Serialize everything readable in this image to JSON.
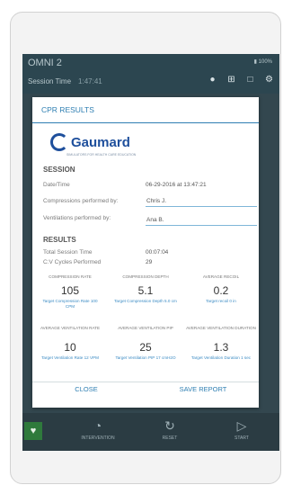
{
  "app": {
    "title": "OMNI 2",
    "battery": "▮ 100%",
    "session_label": "Session Time",
    "session_value": "1:47:41"
  },
  "app_icons": [
    "palette-icon",
    "users-icon",
    "chat-icon",
    "gear-icon"
  ],
  "dialog": {
    "title": "CPR RESULTS",
    "logo": {
      "name": "Gaumard",
      "tagline": "SIMULATORS FOR HEALTH CARE EDUCATION"
    },
    "session": {
      "heading": "SESSION",
      "date_label": "Date/Time",
      "date_value": "06-29-2016 at 13:47:21",
      "compressions_label": "Compressions performed by:",
      "compressions_value": "Chris J.",
      "ventilations_label": "Ventilations performed by:",
      "ventilations_value": "Ana B."
    },
    "results": {
      "heading": "RESULTS",
      "total_label": "Total Session Time",
      "total_value": "00:07:04",
      "cycles_label": "C:V Cycles Performed",
      "cycles_value": "29"
    },
    "stats": [
      {
        "label": "COMPRESSION RATE",
        "value": "105",
        "target": "Target Compression Rate 100 CPM"
      },
      {
        "label": "COMPRESSION DEPTH",
        "value": "5.1",
        "target": "Target Compression Depth 5.0 cm"
      },
      {
        "label": "AVERAGE RECOIL",
        "value": "0.2",
        "target": "Target recoil 0 in"
      },
      {
        "label": "AVERAGE VENTILATION RATE",
        "value": "10",
        "target": "Target Ventilation Rate 12 VPM"
      },
      {
        "label": "AVERAGE VENTILATION PIP",
        "value": "25",
        "target": "Target Ventilation PIP 17 cmH2O"
      },
      {
        "label": "AVERAGE VENTILATION DURATION",
        "value": "1.3",
        "target": "Target Ventilation Duration 1 sec"
      }
    ],
    "close_label": "CLOSE",
    "save_label": "SAVE REPORT"
  },
  "bottom_bar": {
    "items": [
      {
        "label": "INTERVENTION",
        "icon": "stethoscope-icon"
      },
      {
        "label": "RESET",
        "icon": "refresh-icon"
      },
      {
        "label": "START",
        "icon": "play-icon"
      }
    ]
  },
  "colors": {
    "accent": "#2f7fb2",
    "app_bar": "#2c4650",
    "logo": "#1e4f9c"
  }
}
